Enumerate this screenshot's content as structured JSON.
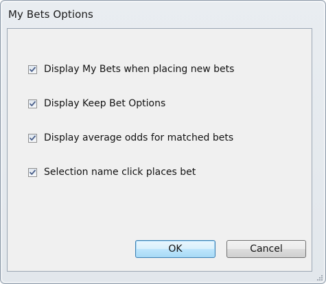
{
  "window": {
    "title": "My Bets Options"
  },
  "options": [
    {
      "label": "Display My Bets when placing new bets",
      "checked": true
    },
    {
      "label": "Display Keep Bet Options",
      "checked": true
    },
    {
      "label": "Display average odds for matched bets",
      "checked": true
    },
    {
      "label": "Selection name click places bet",
      "checked": true
    }
  ],
  "buttons": {
    "ok_label": "OK",
    "cancel_label": "Cancel"
  },
  "colors": {
    "checkmark": "#4a5f8a",
    "default_button_border": "#3c7fb1"
  },
  "icons": {
    "checkbox": "checkbox-checked-icon",
    "resize": "resize-grip-icon"
  }
}
